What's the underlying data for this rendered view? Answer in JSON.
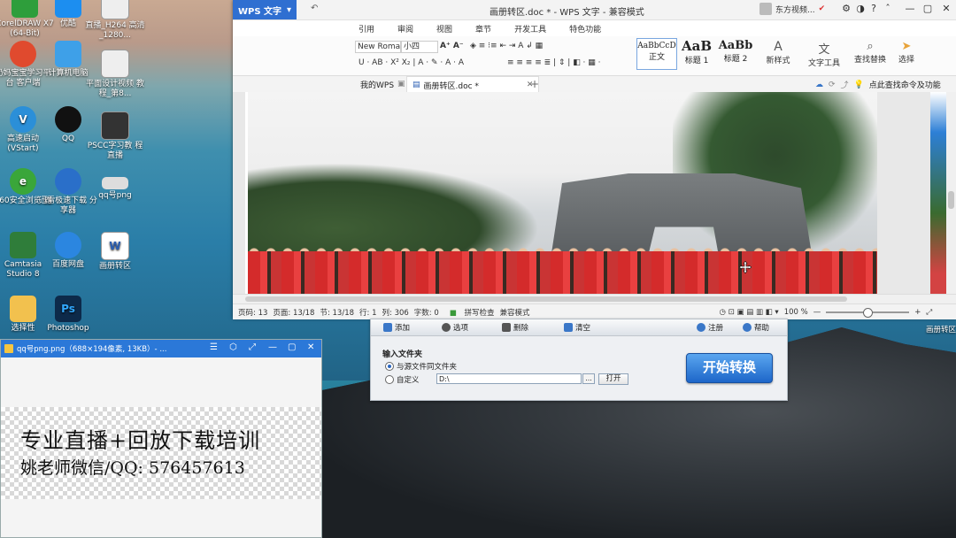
{
  "desktop": {
    "icons": [
      {
        "label": "CorelDRAW X7 (64-Bit)",
        "icon": "coreldraw-icon",
        "color": "#2e9e3b"
      },
      {
        "label": "优酷",
        "icon": "youku-icon",
        "color": "#1c8ef0"
      },
      {
        "label": "直播_H264 高清_1280...",
        "icon": "video-file-icon",
        "color": "#eeeeee"
      },
      {
        "label": "奶妈宝宝学习平台 客户端",
        "icon": "baby-app-icon",
        "color": "#e04a2e"
      },
      {
        "label": "计算机电脑",
        "icon": "computer-icon",
        "color": "#3ea0e8"
      },
      {
        "label": "平面设计视频 教程_第8...",
        "icon": "video-file-icon",
        "color": "#eeeeee"
      },
      {
        "label": "高速启动 (VStart)",
        "icon": "vstart-icon",
        "color": "#2b8fd8"
      },
      {
        "label": "QQ",
        "icon": "qq-icon",
        "color": "#111111"
      },
      {
        "label": "PSCC字习教 程直播",
        "icon": "video-file-icon",
        "color": "#333333"
      },
      {
        "label": "360安全浏览 器",
        "icon": "browser-360-icon",
        "color": "#3aa63a"
      },
      {
        "label": "迅雷极速下载 分享器",
        "icon": "thunder-icon",
        "color": "#2a6fc9"
      },
      {
        "label": "qq号png",
        "icon": "image-file-icon",
        "color": "#dddddd"
      },
      {
        "label": "Camtasia Studio 8",
        "icon": "camtasia-icon",
        "color": "#2f7d3a"
      },
      {
        "label": "百度网盘",
        "icon": "baidu-pan-icon",
        "color": "#2b86e0"
      },
      {
        "label": "画册转区",
        "icon": "word-doc-icon",
        "color": "#ffffff"
      },
      {
        "label": "选择性",
        "icon": "folder-icon",
        "color": "#f2c14e"
      },
      {
        "label": "Photoshop",
        "icon": "photoshop-icon",
        "color": "#0d2a4a"
      }
    ]
  },
  "wps": {
    "logo": "WPS 文字",
    "title": "画册转区.doc * - WPS 文字 - 兼容模式",
    "user": "东方视频...",
    "tabs": [
      "引用",
      "审阅",
      "视图",
      "章节",
      "开发工具",
      "特色功能"
    ],
    "ribbon": {
      "font_name": "New Roma",
      "font_size": "小四",
      "styles": [
        {
          "preview": "AaBbCcD",
          "name": "正文"
        },
        {
          "preview": "AaB",
          "name": "标题 1"
        },
        {
          "preview": "AaBb",
          "name": "标题 2"
        }
      ],
      "new_style": "新样式",
      "text_tools": "文字工具",
      "find_replace": "查找替换",
      "select": "选择"
    },
    "doc_tabs": [
      {
        "label": "我的WPS"
      },
      {
        "label": "画册转区.doc *"
      }
    ],
    "search_hint": "点此查找命令及功能",
    "status": {
      "page": "页码: 13",
      "pages": "页面: 13/18",
      "section": "节: 13/18",
      "row": "行: 1",
      "col": "列: 306",
      "words": "字数: 0",
      "spell": "拼写检查",
      "mode": "兼容模式",
      "zoom": "100 %"
    },
    "zoom_value": 0.47
  },
  "converter": {
    "toolbar": [
      {
        "label": "添加",
        "icon": "add-icon"
      },
      {
        "label": "选项",
        "icon": "gear-icon"
      },
      {
        "label": "删除",
        "icon": "trash-icon"
      },
      {
        "label": "清空",
        "icon": "broom-icon"
      },
      {
        "label": "注册",
        "icon": "info-icon"
      },
      {
        "label": "帮助",
        "icon": "help-icon"
      }
    ],
    "section_label": "输入文件夹",
    "radio_same": "与源文件同文件夹",
    "radio_custom": "自定义",
    "path": "D:\\",
    "browse": "...",
    "open": "打开",
    "start": "开始转换",
    "side_label": "画册转区"
  },
  "viewer": {
    "title": "qq号png.png（688×194像素, 13KB）- ...",
    "line1": "专业直播+回放下载培训",
    "line2": "姚老师微信/QQ:  576457613"
  },
  "colors": {
    "wps_blue": "#2f6fd1",
    "viewer_title": "#2b78d8",
    "start_button": "#1d66c9"
  }
}
